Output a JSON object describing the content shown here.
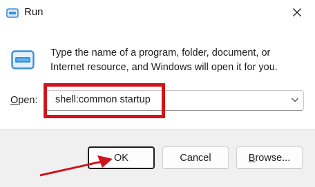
{
  "window": {
    "title": "Run",
    "icons": {
      "title": "run-icon",
      "close": "close-icon",
      "app": "run-app-icon",
      "dropdown": "chevron-down-icon",
      "annotation": "red-arrow"
    }
  },
  "description": {
    "line1": "Type the name of a program, folder, document, or",
    "line2": "Internet resource, and Windows will open it for you."
  },
  "open": {
    "label_mnemonic": "O",
    "label_rest": "pen:",
    "value": "shell:common startup"
  },
  "buttons": {
    "ok": "OK",
    "cancel": "Cancel",
    "browse_mnemonic": "B",
    "browse_rest": "rowse..."
  },
  "colors": {
    "highlight": "#d1141b",
    "icon_blue": "#3a8fd9"
  }
}
